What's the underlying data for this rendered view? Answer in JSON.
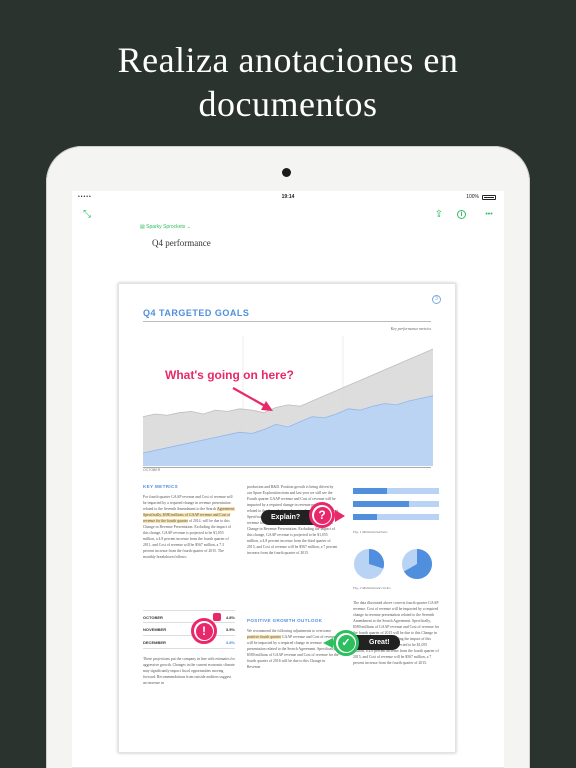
{
  "headline": {
    "line1": "Realiza anotaciones en",
    "line2": "documentos"
  },
  "status_bar": {
    "carrier": "•••••  ",
    "time": "19:14",
    "battery": "100%"
  },
  "toolbar": {
    "icons": [
      "collapse-icon",
      "share-icon",
      "info-icon",
      "more-icon"
    ],
    "more_glyph": "•••",
    "info_glyph": "i",
    "share_glyph": "⇪",
    "collapse_glyph": "⤡"
  },
  "note": {
    "notebook": "Sparky Sprockets",
    "notebook_glyph": "▤",
    "title": "Q4 performance"
  },
  "document": {
    "badge": "3",
    "heading": "Q4 TARGETED GOALS",
    "chart_subtitle": "Key performance metrics",
    "x_label": "OCTOBER",
    "key_metrics": {
      "heading": "KEY METRICS",
      "text_pre": "For fourth quarter GAAP revenue and Cost of revenue will be impacted by a required change in revenue presentation related to the Seventh Amendment to the Search ",
      "text_hl": "Agreement. Specifically, $580 millions of GAAP revenue and Cost of revenue for the fourth quarter",
      "text_post": " of 2014, will be due to this Change in Revenue Presentation. Excluding the impact of this change, GAAP revenue is projected to be $1,055 million, a 4.8 percent increase from the fourth quarter of 2011, and Cost of revenue will be $567 million, a 7.3 percent increase from the fourth quarter of 2015. The monthly breakdown follows:"
    },
    "months": [
      {
        "name": "OCTOBER",
        "pct": "4.8%"
      },
      {
        "name": "NOVEMBER",
        "pct": "3.5%"
      },
      {
        "name": "DECEMBER",
        "pct": "3.8%"
      }
    ],
    "outro": "These projections put the company in line with estimates for aggressive growth. Changes in the current economic climate may significantly impact fiscal opportunities moving forward. Recommendations from outside auditors suggest an increase in",
    "middle_col": "production and R&D. Position growth is being driven by our Spare Exploration team and last year we still see the Fourth quarter GAAP revenue and Cost of revenue will be impacted by a required change in revenue presentation related to the Seventh Amendment to the Search Agreement. Specifically, $580 millions of GAAP revenue and Cost of revenue for the fourth quarter of 2016 will be due to this Change in Revenue Presentation. Excluding the impact of this change, GAAP revenue is projected to be $1,055 million, a 4.8 percent increase from the third quarter of 2015, and Cost of revenue will be $567 million, a 7 percent increase from the fourth quarter of 2015.",
    "growth": {
      "heading": "POSITIVE GROWTH OUTLOOK",
      "text_pre": "We recommend the following adjustments to overcome ",
      "text_hl": "positive fourth quarter",
      "text_post": " GAAP revenue and Cost of revenue will be impacted by a required change in revenue presentation related to the Search Agreement. Specifically, $580 millions of GAAP revenue and Cost of revenue for the fourth quarter of 2016 will be due to this Change in Revenue"
    },
    "fig1": "Fig. 1    Multicolored bars",
    "fig2": "Fig. 2    Multicolored circles",
    "right_col": "The data illustrated above corrects fourth quarter GAAP revenue. Cost of revenue will be impacted by a required change in revenue presentation related to the Seventh Amendment to the Search Agreement. Specifically, $580 millions of GAAP revenue and Cost of revenue for the fourth quarter of 2015 will be due to this Change in Revenue Presentation. Excluding the impact of this change, GAAP revenue is projected to be $1,055 million, a 4.8 percent increase from the fourth quarter of 2015, and Cost of revenue will be $567 million, a 7 percent increase from the fourth quarter of 2015."
  },
  "annotations": {
    "chart_note": "What's going on here?",
    "explain": "Explain?",
    "question_glyph": "?",
    "exclaim_glyph": "!",
    "great": "Great!",
    "check_glyph": "✓"
  },
  "bottom_bar": {
    "icons": [
      "camera-icon",
      "highlighter-icon",
      "pen-icon",
      "attachment-icon"
    ],
    "camera_glyph": "◙",
    "highlighter_glyph": "✎",
    "pen_glyph": "✐",
    "attachment_glyph": "⌇"
  },
  "colors": {
    "background": "#2b332e",
    "accent_green": "#2dbe60",
    "annotation_pink": "#e8286b",
    "chart_blue": "#b9d3f4",
    "chart_gray": "#d9d9d9",
    "heading_blue": "#4f8fde"
  },
  "chart_data": {
    "type": "area",
    "title": "Q4 TARGETED GOALS",
    "subtitle": "Key performance metrics",
    "xlabel": "OCTOBER",
    "ylabel": "",
    "x": [
      0,
      1,
      2,
      3,
      4,
      5,
      6,
      7,
      8,
      9,
      10,
      11,
      12,
      13,
      14,
      15,
      16,
      17,
      18,
      19,
      20,
      21,
      22,
      23,
      24
    ],
    "ylim": [
      0,
      100
    ],
    "series": [
      {
        "name": "",
        "values": [
          38,
          40,
          39,
          41,
          42,
          40,
          43,
          42,
          44,
          43,
          41,
          45,
          47,
          46,
          50,
          54,
          58,
          62,
          66,
          70,
          74,
          78,
          82,
          86,
          90
        ]
      },
      {
        "name": "",
        "values": [
          10,
          12,
          14,
          16,
          18,
          20,
          22,
          24,
          26,
          25,
          28,
          32,
          30,
          34,
          38,
          37,
          40,
          44,
          43,
          46,
          48,
          47,
          50,
          52,
          54
        ]
      }
    ]
  }
}
